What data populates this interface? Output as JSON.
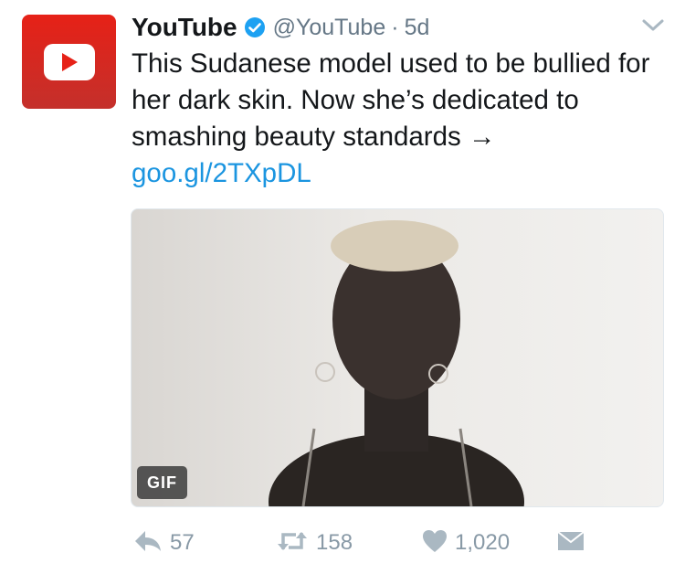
{
  "tweet": {
    "display_name": "YouTube",
    "handle": "@YouTube",
    "separator": "·",
    "time": "5d",
    "text": "This Sudanese model used to be bullied for her dark skin. Now she’s dedicated to smashing beauty standards → ",
    "link": "goo.gl/2TXpDL",
    "media_badge": "GIF"
  },
  "actions": {
    "reply_count": "57",
    "retweet_count": "158",
    "like_count": "1,020"
  },
  "icons": {
    "avatar": "youtube-logo-icon",
    "verified": "verified-badge-icon",
    "menu": "chevron-down-icon",
    "reply": "reply-icon",
    "retweet": "retweet-icon",
    "like": "heart-icon",
    "dm": "envelope-icon"
  },
  "colors": {
    "brand": "#e62117",
    "link": "#1b95e0",
    "verified": "#1da1f2",
    "muted": "#8899a6"
  }
}
